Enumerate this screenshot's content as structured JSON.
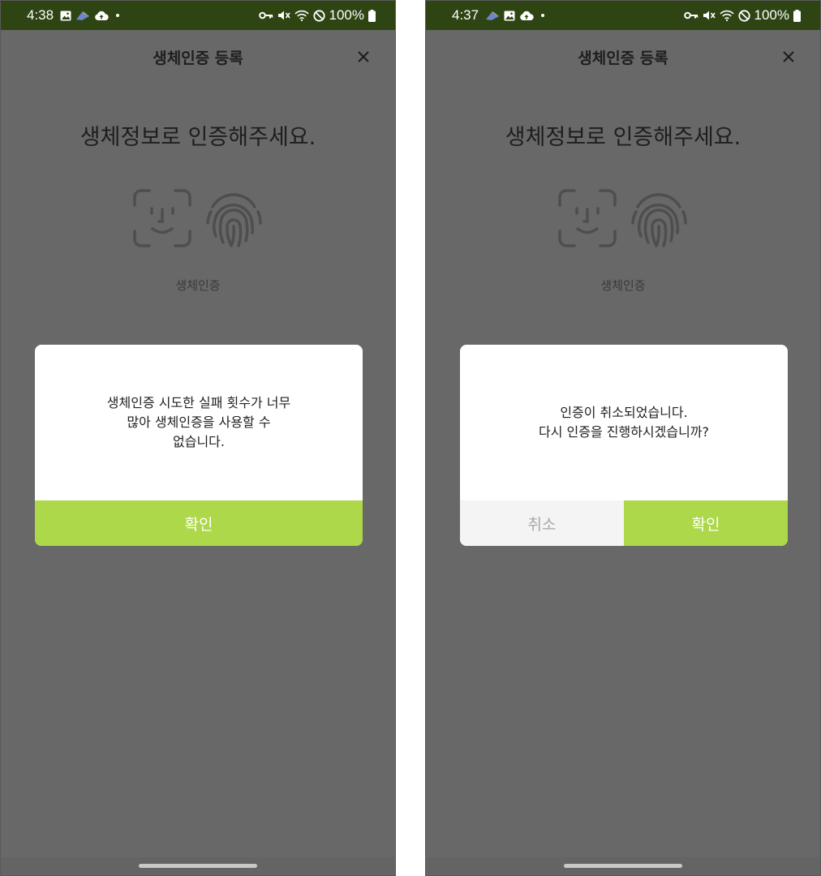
{
  "screens": [
    {
      "status": {
        "time": "4:38",
        "battery": "100%"
      },
      "header": {
        "title": "생체인증 등록"
      },
      "headline": "생체정보로 인증해주세요.",
      "bio_label": "생체인증",
      "dialog": {
        "lines": [
          "생체인증 시도한 실패 횟수가 너무",
          "많아 생체인증을 사용할 수",
          "없습니다."
        ],
        "confirm_label": "확인"
      }
    },
    {
      "status": {
        "time": "4:37",
        "battery": "100%"
      },
      "header": {
        "title": "생체인증 등록"
      },
      "headline": "생체정보로 인증해주세요.",
      "bio_label": "생체인증",
      "dialog": {
        "lines": [
          "인증이 취소되었습니다.",
          "다시 인증을 진행하시겠습니까?"
        ],
        "cancel_label": "취소",
        "confirm_label": "확인"
      }
    }
  ],
  "colors": {
    "status_bar": "#2e4413",
    "overlay": "#686868",
    "accent": "#acd84a",
    "cancel_bg": "#f4f4f4",
    "cancel_text": "#a8a8a8"
  },
  "icons": {
    "status_left": [
      "gallery-icon",
      "app-notification-icon",
      "cloud-upload-icon"
    ],
    "status_right": [
      "vpn-key-icon",
      "mute-icon",
      "wifi-icon",
      "do-not-disturb-icon",
      "battery-icon"
    ],
    "biometric": [
      "face-id-icon",
      "fingerprint-icon"
    ],
    "close": "close-icon"
  }
}
